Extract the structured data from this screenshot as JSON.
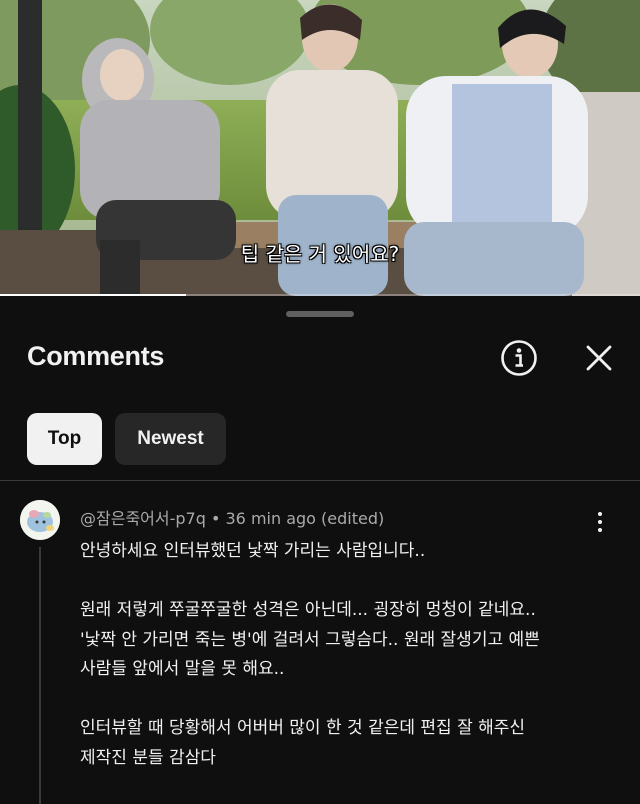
{
  "video": {
    "subtitle": "팁 같은 거 있어요?",
    "progress": 0.29
  },
  "comments_panel": {
    "title": "Comments",
    "info_icon": "info-icon",
    "close_icon": "close-icon",
    "filters": [
      {
        "label": "Top",
        "selected": true
      },
      {
        "label": "Newest",
        "selected": false
      }
    ]
  },
  "comment": {
    "author": "@잠은죽어서-p7q",
    "separator": "•",
    "time": "36 min ago",
    "edited": "(edited)",
    "paragraphs": [
      [
        "안녕하세요 인터뷰했던 낯짝 가리는 사람입니다.."
      ],
      [
        "원래 저렇게 쭈굴쭈굴한 성격은 아닌데... 굉장히 멍청이 같네요..",
        "'낯짝 안 가리면 죽는 병'에 걸려서 그렇슴다.. 원래 잘생기고 예쁜",
        "사람들 앞에서 말을 못 해요.."
      ],
      [
        "인터뷰할 때 당황해서 어버버 많이 한 것 같은데 편집 잘 해주신",
        "제작진 분들 감삼다"
      ]
    ]
  },
  "colors": {
    "background": "#0f0f0f",
    "chip_selected": "#f1f1f1",
    "chip_unselected": "#272727",
    "secondary_text": "#aaaaaa"
  }
}
